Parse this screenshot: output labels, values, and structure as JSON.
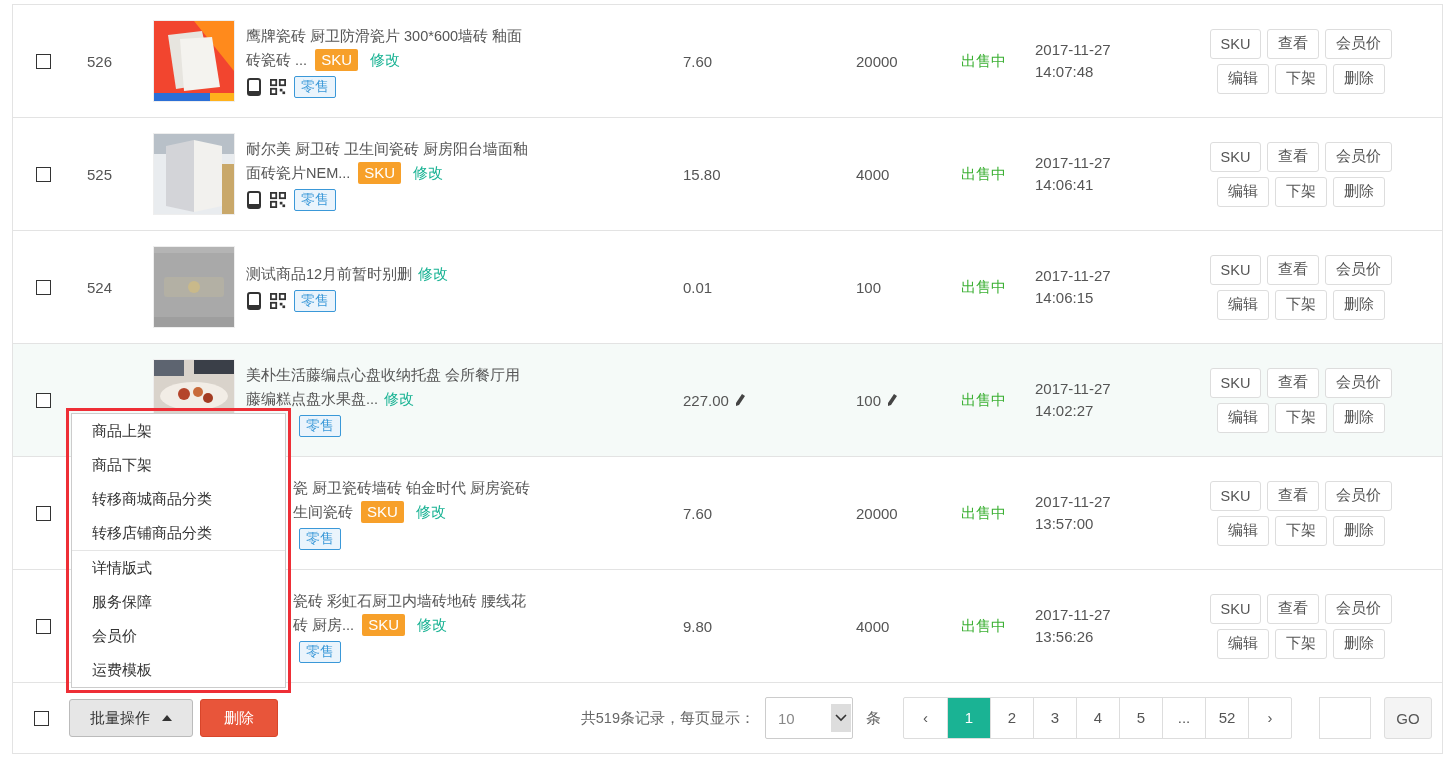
{
  "rows": [
    {
      "kind": "full",
      "checked": false,
      "id": "526",
      "title_lines": [
        "鹰牌瓷砖 厨卫防滑瓷片 300*600墙砖 釉面",
        "砖瓷砖 ..."
      ],
      "sku": "SKU",
      "edit": "修改",
      "tag": "零售",
      "price": "7.60",
      "stock": "20000",
      "editable": false,
      "status": "出售中",
      "date": "2017-11-27",
      "time": "14:07:48",
      "actions": [
        "SKU",
        "查看",
        "会员价",
        "编辑",
        "下架",
        "删除"
      ]
    },
    {
      "kind": "full",
      "checked": false,
      "id": "525",
      "title_lines": [
        "耐尔美 厨卫砖 卫生间瓷砖 厨房阳台墙面釉",
        "面砖瓷片NEM..."
      ],
      "sku": "SKU",
      "edit": "修改",
      "tag": "零售",
      "price": "15.80",
      "stock": "4000",
      "editable": false,
      "status": "出售中",
      "date": "2017-11-27",
      "time": "14:06:41",
      "actions": [
        "SKU",
        "查看",
        "会员价",
        "编辑",
        "下架",
        "删除"
      ]
    },
    {
      "kind": "full",
      "checked": false,
      "id": "524",
      "title_lines": [
        "测试商品12月前暂时别删"
      ],
      "edit": "修改",
      "tag": "零售",
      "price": "0.01",
      "stock": "100",
      "editable": false,
      "status": "出售中",
      "date": "2017-11-27",
      "time": "14:06:15",
      "actions": [
        "SKU",
        "查看",
        "会员价",
        "编辑",
        "下架",
        "删除"
      ]
    },
    {
      "kind": "partial",
      "checked": false,
      "title_lines": [
        "美朴生活藤编点心盘收纳托盘 会所餐厅用",
        "藤编糕点盘水果盘..."
      ],
      "edit": "修改",
      "tag": "零售",
      "price": "227.00",
      "stock": "100",
      "editable": true,
      "status": "出售中",
      "date": "2017-11-27",
      "time": "14:02:27",
      "actions": [
        "SKU",
        "查看",
        "会员价",
        "编辑",
        "下架",
        "删除"
      ]
    },
    {
      "kind": "covered",
      "checked": false,
      "title_lines": [
        "瓷 厨卫瓷砖墙砖 铂金时代 厨房瓷砖",
        "生间瓷砖"
      ],
      "sku": "SKU",
      "edit": "修改",
      "tag": "零售",
      "price": "7.60",
      "stock": "20000",
      "editable": false,
      "status": "出售中",
      "date": "2017-11-27",
      "time": "13:57:00",
      "actions": [
        "SKU",
        "查看",
        "会员价",
        "编辑",
        "下架",
        "删除"
      ]
    },
    {
      "kind": "covered",
      "checked": false,
      "title_lines": [
        "瓷砖 彩虹石厨卫内墙砖地砖 腰线花",
        "砖 厨房..."
      ],
      "sku": "SKU",
      "edit": "修改",
      "tag": "零售",
      "price": "9.80",
      "stock": "4000",
      "editable": false,
      "status": "出售中",
      "date": "2017-11-27",
      "time": "13:56:26",
      "actions": [
        "SKU",
        "查看",
        "会员价",
        "编辑",
        "下架",
        "删除"
      ]
    }
  ],
  "footer": {
    "checked": false,
    "batch_button": "批量操作",
    "delete_button": "删除",
    "menu": {
      "groups": [
        [
          "商品上架",
          "商品下架",
          "转移商城商品分类",
          "转移店铺商品分类"
        ],
        [
          "详情版式",
          "服务保障",
          "会员价",
          "运费模板"
        ]
      ]
    },
    "records": "共519条记录，每页显示：",
    "page_size": "10",
    "unit": "条",
    "pages": [
      {
        "label": "‹",
        "selected": false
      },
      {
        "label": "1",
        "selected": true
      },
      {
        "label": "2",
        "selected": false
      },
      {
        "label": "3",
        "selected": false
      },
      {
        "label": "4",
        "selected": false
      },
      {
        "label": "5",
        "selected": false
      },
      {
        "label": "...",
        "selected": false
      },
      {
        "label": "52",
        "selected": false
      },
      {
        "label": "›",
        "selected": false
      }
    ],
    "go_button": "GO"
  }
}
